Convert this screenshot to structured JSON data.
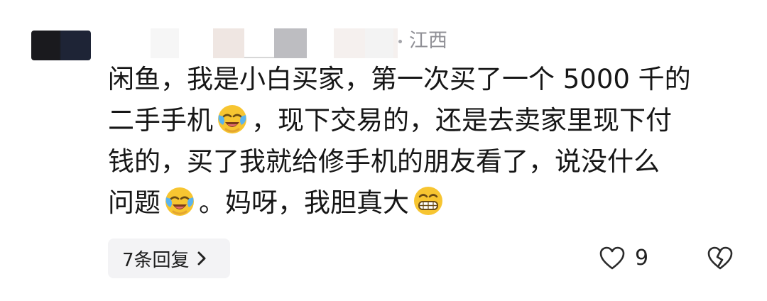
{
  "comment": {
    "location": "江西",
    "lines": [
      [
        "闲鱼，我是小白买家，第一次买了一个 5000 千的"
      ],
      [
        "二手手机",
        "，现下交易的，还是去卖家里现下付"
      ],
      [
        "钱的，买了我就给修手机的朋友看了，说没什么"
      ],
      [
        "问题",
        "。妈呀，我胆真大"
      ]
    ],
    "emojis": [
      "face-with-tears-of-joy-icon",
      "grinning-face-icon"
    ]
  },
  "footer": {
    "replies_label": "7条回复",
    "like_count": "9"
  },
  "colors": {
    "text": "#161616",
    "muted": "#909096",
    "pill_bg": "#f3f3f5",
    "emoji_yellow": "#f7c531"
  }
}
